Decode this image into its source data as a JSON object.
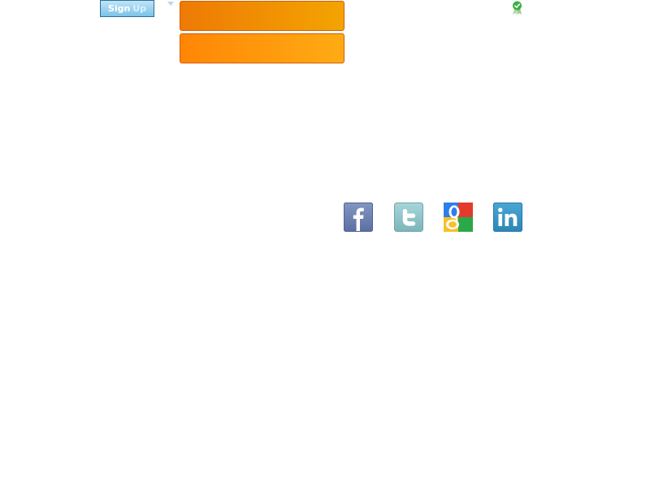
{
  "header": {
    "signup_label_part1": "Sign",
    "signup_label_part2": "Up"
  },
  "badge": {
    "icon": "verified-check-icon",
    "color": "#3cb043"
  },
  "social": {
    "items": [
      {
        "icon": "facebook-icon",
        "color": "#6c7fb0"
      },
      {
        "icon": "twitter-icon",
        "color": "#8ec3c8"
      },
      {
        "icon": "google-icon",
        "color": "#4285f4"
      },
      {
        "icon": "linkedin-icon",
        "color": "#2b8bb8"
      }
    ]
  },
  "colors": {
    "orange_primary": "#f08a04",
    "orange_secondary": "#ff9a0c",
    "signup_blue": "#8fcdee"
  }
}
